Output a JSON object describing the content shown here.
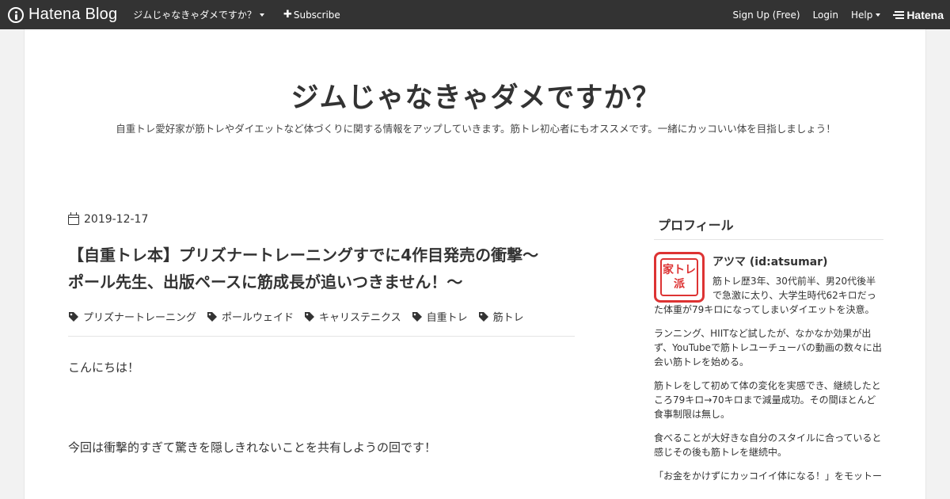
{
  "topbar": {
    "logo_text": "Hatena Blog",
    "blog_menu_label": "ジムじゃなきゃダメですか？",
    "subscribe_label": "Subscribe",
    "signup_label": "Sign Up (Free)",
    "login_label": "Login",
    "help_label": "Help",
    "hatena_logo_text": "Hatena",
    "bg_color": "#333333"
  },
  "blog": {
    "title": "ジムじゃなきゃダメですか？",
    "description": "自重トレ愛好家が筋トレやダイエットなど体づくりに関する情報をアップしていきます。筋トレ初心者にもオススメです。一緒にカッコいい体を目指しましょう！"
  },
  "entry": {
    "date": "2019-12-17",
    "title_line1": "【自重トレ本】プリズナートレーニングすでに4作目発売の衝撃〜",
    "title_line2": "ポール先生、出版ペースに筋成長が追いつきません！〜",
    "tags": [
      "プリズナートレーニング",
      "ポールウェイド",
      "キャリステニクス",
      "自重トレ",
      "筋トレ"
    ],
    "paragraphs": [
      "こんにちは！",
      "今回は衝撃的すぎて驚きを隠しきれないことを共有しようの回です！"
    ]
  },
  "sidebar": {
    "profile_heading": "プロフィール",
    "avatar_text_line1": "家トレ",
    "avatar_text_line2": "派",
    "profile_name": "アツマ (id:atsumar)",
    "profile_intro": "筋トレ歴3年、30代前半、男20代後半で急激に太り、大学生時代62キロだった体重が79キロになってしまいダイエットを決意。",
    "paragraphs": [
      "ランニング、HIITなど試したが、なかなか効果が出ず、YouTubeで筋トレユーチューバの動画の数々に出会い筋トレを始める。",
      "筋トレをして初めて体の変化を実感でき、継続したところ79キロ→70キロまで減量成功。その間ほとんど食事制限は無し。",
      "食べることが大好きな自分のスタイルに合っていると感じその後も筋トレを継続中。",
      "「お金をかけずにカッコイイ体になる！」をモットー"
    ],
    "accent_color": "#dd3333"
  }
}
